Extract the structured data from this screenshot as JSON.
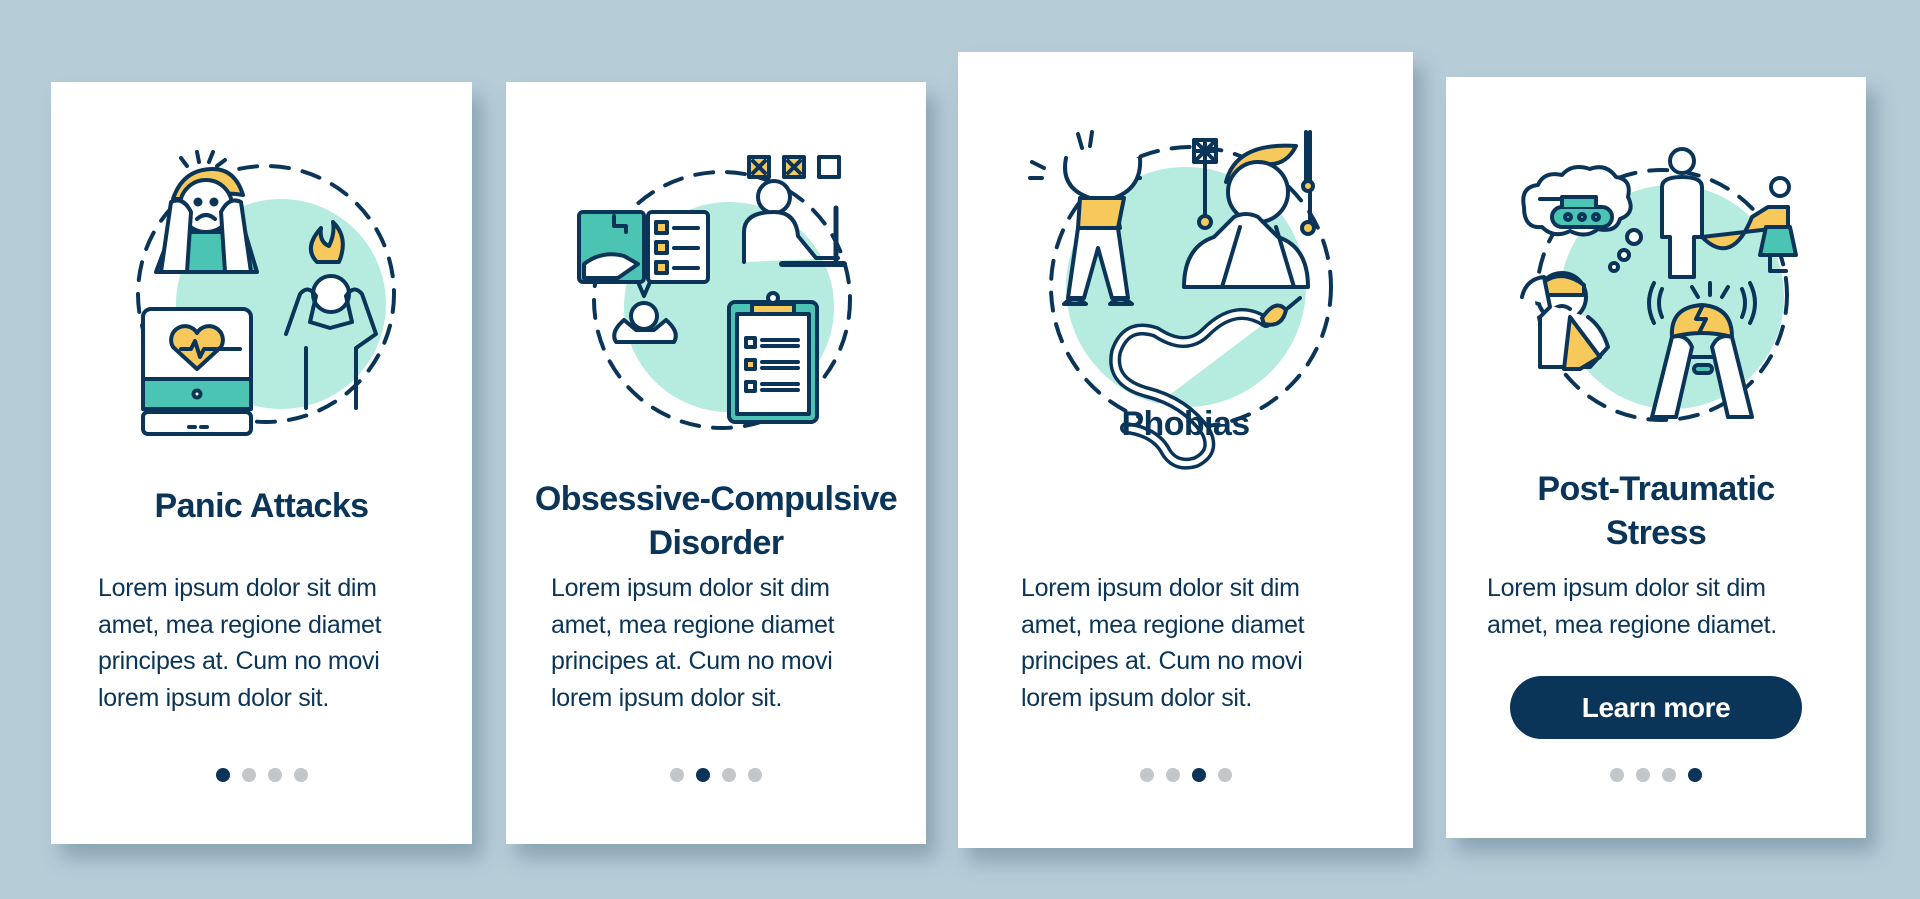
{
  "colors": {
    "background": "#b6cdd8",
    "card": "#ffffff",
    "text": "#0b3558",
    "accent_mint": "#b5ecdf",
    "accent_teal": "#4cc4b4",
    "accent_yellow": "#f7c95a",
    "dot_inactive": "#c4c7c9",
    "dot_active": "#0b3558"
  },
  "cards": [
    {
      "illustration": "panic-attacks-illustration",
      "title_lines": [
        "Panic Attacks"
      ],
      "body_lines": [
        "Lorem ipsum dolor sit dim",
        "amet, mea regione diamet",
        "principes at. Cum no movi",
        "lorem ipsum dolor sit."
      ],
      "page_index": 1,
      "page_count": 4
    },
    {
      "illustration": "ocd-illustration",
      "title_lines": [
        "Obsessive-Compulsive",
        "Disorder"
      ],
      "body_lines": [
        "Lorem ipsum dolor sit dim",
        "amet, mea regione diamet",
        "principes at. Cum no movi",
        "lorem ipsum dolor sit."
      ],
      "page_index": 2,
      "page_count": 4
    },
    {
      "illustration": "phobias-illustration",
      "title_lines": [
        "Phobias"
      ],
      "body_lines": [
        "Lorem ipsum dolor sit dim",
        "amet, mea regione diamet",
        "principes at. Cum no movi",
        "lorem ipsum dolor sit."
      ],
      "page_index": 3,
      "page_count": 4
    },
    {
      "illustration": "ptsd-illustration",
      "title_lines": [
        "Post-Traumatic",
        "Stress"
      ],
      "body_lines": [
        "Lorem ipsum dolor sit dim",
        "amet, mea regione diamet."
      ],
      "button_label": "Learn more",
      "page_index": 4,
      "page_count": 4
    }
  ]
}
